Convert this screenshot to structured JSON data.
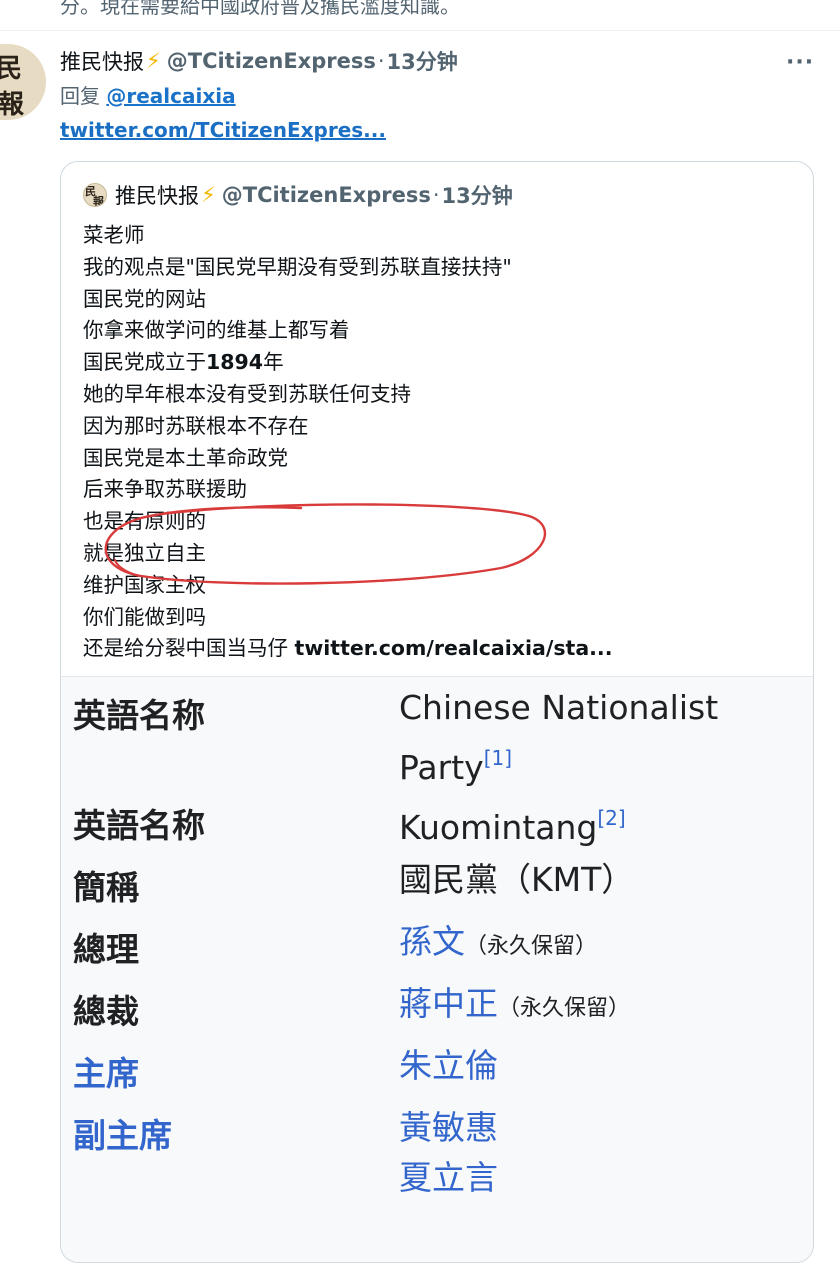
{
  "top_fragment": "分。現在需要給中國政府普及攜民濫度知識。",
  "tweet": {
    "avatar_chars": [
      "民",
      "報"
    ],
    "name": "推民快报",
    "badge_icon": "lightning-bolt-icon",
    "handle": "@TCitizenExpress",
    "separator": "·",
    "time": "13分钟",
    "more": "···",
    "reply_prefix": "回复",
    "reply_to": "@realcaixia",
    "link": "twitter.com/TCitizenExpres..."
  },
  "quote": {
    "name": "推民快报",
    "handle": "@TCitizenExpress",
    "separator": "·",
    "time": "13分钟",
    "lines": [
      "菜老师",
      "我的观点是\"国民党早期没有受到苏联直接扶持\"",
      "国民党的网站",
      "你拿来做学问的维基上都写着",
      "国民党成立于",
      "她的早年根本没有受到苏联任何支持",
      "因为那时苏联根本不存在",
      "国民党是本土革命政党",
      "后来争取苏联援助",
      "也是有原则的",
      "就是独立自主",
      "维护国家主权",
      "你们能做到吗",
      "还是给分裂中国当马仔"
    ],
    "founded_year": "1894",
    "founded_suffix": "年",
    "tail_link": "twitter.com/realcaixia/sta...",
    "annotation_color": "#d93a3a"
  },
  "wiki": {
    "rows": [
      {
        "label": "英語名称",
        "value": "Chinese Nationalist",
        "value2": "Party",
        "ref": "[1]"
      },
      {
        "label": "英語名称",
        "value": "Kuomintang",
        "ref": "[2]"
      },
      {
        "label": "簡稱",
        "value": "國民黨（KMT）"
      },
      {
        "label": "總理",
        "value_link": "孫文",
        "note": "（永久保留）"
      },
      {
        "label": "總裁",
        "value_link": "蔣中正",
        "note": "（永久保留）"
      },
      {
        "label": "主席",
        "value_link": "朱立倫"
      },
      {
        "label": "副主席",
        "value_link": "黃敏惠",
        "value_link2": "夏立言"
      }
    ],
    "link_color": "#3366cc"
  }
}
